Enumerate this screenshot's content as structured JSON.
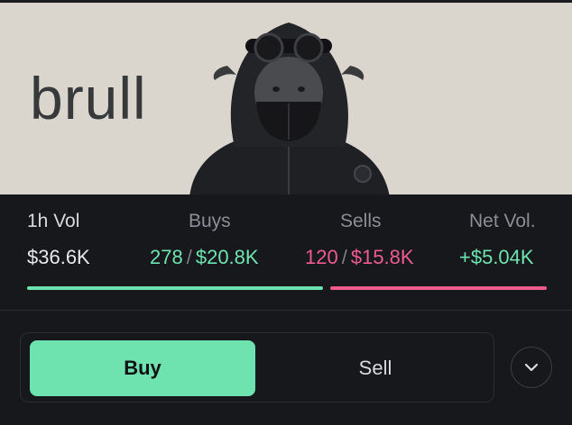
{
  "banner": {
    "brand_text": "brull",
    "mascot_icon": "hooded-bull-icon",
    "background_color": "#dad5cd"
  },
  "stats": {
    "volume": {
      "label": "1h Vol",
      "value": "$36.6K"
    },
    "buys": {
      "label": "Buys",
      "count": "278",
      "amount": "$20.8K"
    },
    "sells": {
      "label": "Sells",
      "count": "120",
      "amount": "$15.8K"
    },
    "net": {
      "label": "Net Vol.",
      "value": "+$5.04K"
    },
    "separator": "/",
    "buy_share": 0.577,
    "colors": {
      "buy": "#6ee3b0",
      "sell": "#ee5b8d"
    }
  },
  "trade": {
    "buy_label": "Buy",
    "sell_label": "Sell",
    "selected": "Buy",
    "dropdown_icon": "chevron-down-icon"
  }
}
